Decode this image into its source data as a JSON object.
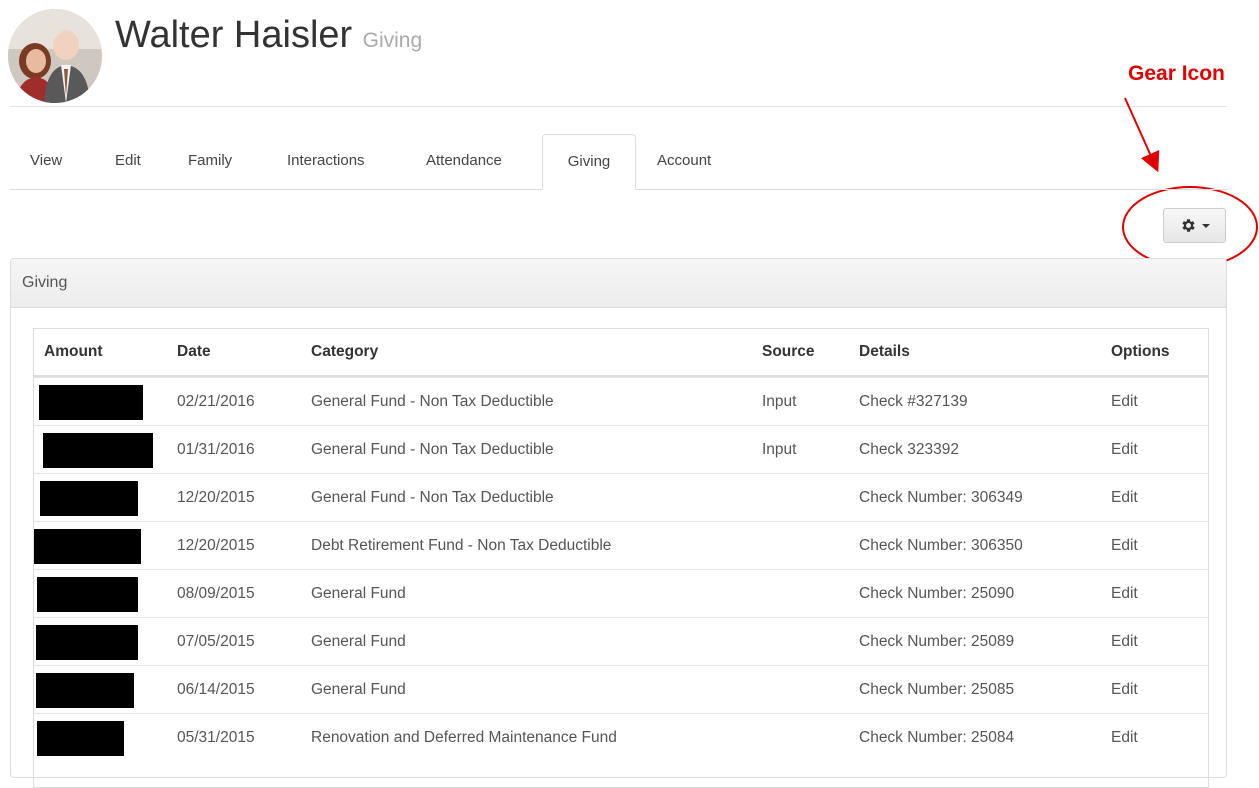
{
  "header": {
    "name": "Walter Haisler",
    "section": "Giving"
  },
  "annotation": {
    "label": "Gear Icon",
    "color": "#e00000"
  },
  "tabs": [
    {
      "label": "View"
    },
    {
      "label": "Edit"
    },
    {
      "label": "Family"
    },
    {
      "label": "Interactions"
    },
    {
      "label": "Attendance"
    },
    {
      "label": "Giving",
      "active": true
    },
    {
      "label": "Account"
    }
  ],
  "toolbar": {
    "gear_icon": "gear-icon",
    "menu_caret": "caret-down-icon"
  },
  "panel": {
    "title": "Giving"
  },
  "table": {
    "columns": [
      "Amount",
      "Date",
      "Category",
      "Source",
      "Details",
      "Options"
    ],
    "rows": [
      {
        "amount_redacted": true,
        "date": "02/21/2016",
        "category": "General Fund - Non Tax Deductible",
        "source": "Input",
        "details": "Check #327139",
        "option": "Edit"
      },
      {
        "amount_redacted": true,
        "date": "01/31/2016",
        "category": "General Fund - Non Tax Deductible",
        "source": "Input",
        "details": "Check 323392",
        "option": "Edit"
      },
      {
        "amount_redacted": true,
        "date": "12/20/2015",
        "category": "General Fund - Non Tax Deductible",
        "source": "",
        "details": "Check Number: 306349",
        "option": "Edit"
      },
      {
        "amount_redacted": true,
        "date": "12/20/2015",
        "category": "Debt Retirement Fund - Non Tax Deductible",
        "source": "",
        "details": "Check Number: 306350",
        "option": "Edit"
      },
      {
        "amount_redacted": true,
        "date": "08/09/2015",
        "category": "General Fund",
        "source": "",
        "details": "Check Number: 25090",
        "option": "Edit"
      },
      {
        "amount_redacted": true,
        "date": "07/05/2015",
        "category": "General Fund",
        "source": "",
        "details": "Check Number: 25089",
        "option": "Edit"
      },
      {
        "amount_redacted": true,
        "date": "06/14/2015",
        "category": "General Fund",
        "source": "",
        "details": "Check Number: 25085",
        "option": "Edit"
      },
      {
        "amount_redacted": true,
        "date": "05/31/2015",
        "category": "Renovation and Deferred Maintenance Fund",
        "source": "",
        "details": "Check Number: 25084",
        "option": "Edit"
      }
    ]
  }
}
